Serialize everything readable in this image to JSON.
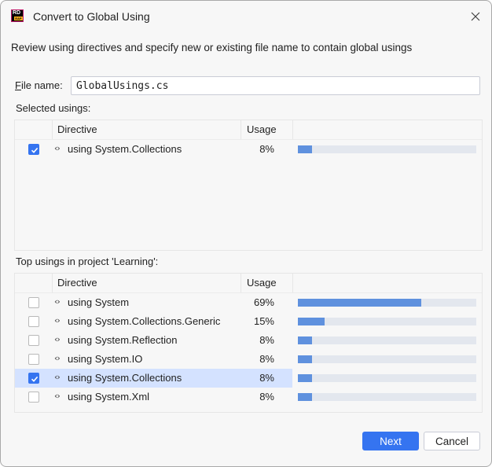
{
  "window": {
    "title": "Convert to Global Using",
    "app_logo_text": "RD",
    "app_logo_badge": "EAP"
  },
  "description": "Review using directives and specify new or existing file name to contain global usings",
  "file_name": {
    "label_mnemonic": "F",
    "label_rest": "ile name:",
    "value": "GlobalUsings.cs"
  },
  "selected_usings": {
    "label": "Selected usings:",
    "columns": [
      "",
      "Directive",
      "Usage",
      ""
    ],
    "rows": [
      {
        "checked": true,
        "directive": "using System.Collections",
        "usage": "8%",
        "usage_fraction": 0.08
      }
    ]
  },
  "top_usings": {
    "label": "Top usings in project 'Learning':",
    "columns": [
      "",
      "Directive",
      "Usage",
      ""
    ],
    "rows": [
      {
        "checked": false,
        "selected": false,
        "directive": "using System",
        "usage": "69%",
        "usage_fraction": 0.69
      },
      {
        "checked": false,
        "selected": false,
        "directive": "using System.Collections.Generic",
        "usage": "15%",
        "usage_fraction": 0.15
      },
      {
        "checked": false,
        "selected": false,
        "directive": "using System.Reflection",
        "usage": "8%",
        "usage_fraction": 0.08
      },
      {
        "checked": false,
        "selected": false,
        "directive": "using System.IO",
        "usage": "8%",
        "usage_fraction": 0.08
      },
      {
        "checked": true,
        "selected": true,
        "directive": "using System.Collections",
        "usage": "8%",
        "usage_fraction": 0.08
      },
      {
        "checked": false,
        "selected": false,
        "directive": "using System.Xml",
        "usage": "8%",
        "usage_fraction": 0.08
      }
    ]
  },
  "buttons": {
    "next": "Next",
    "cancel": "Cancel"
  },
  "colors": {
    "accent": "#3574f0",
    "bar_fill": "#5f91de",
    "bar_track": "#e3e7ee",
    "row_selected": "#d4e2ff"
  },
  "icons": {
    "close": "close-icon",
    "namespace": "namespace-icon",
    "check": "check-icon"
  }
}
